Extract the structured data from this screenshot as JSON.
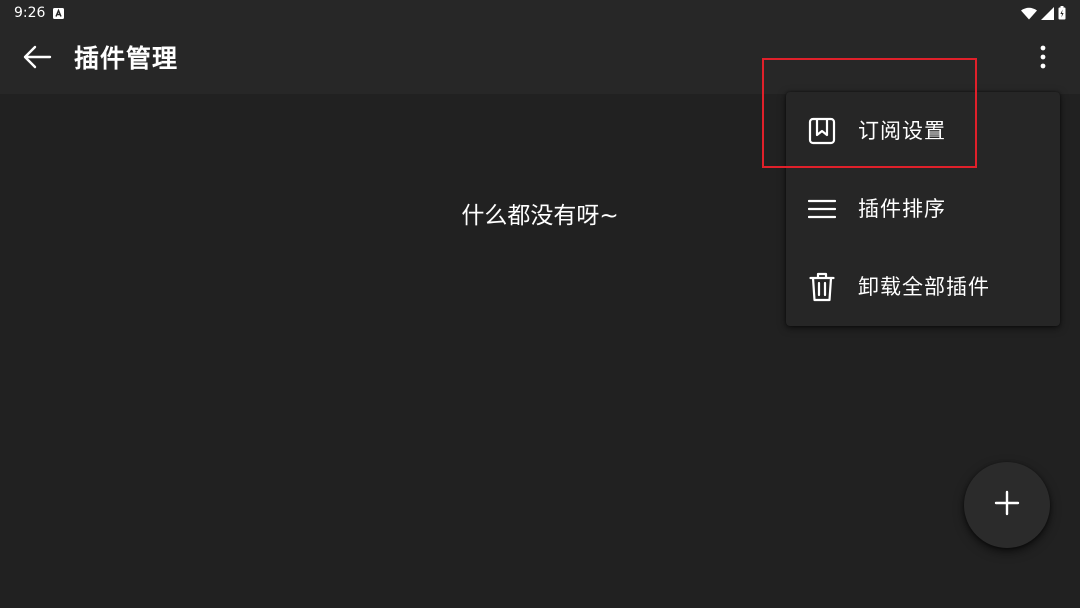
{
  "status_bar": {
    "time": "9:26",
    "icons": [
      "notification-a-icon",
      "wifi-icon",
      "cellular-signal-icon",
      "battery-icon"
    ]
  },
  "app_bar": {
    "title": "插件管理",
    "back_icon": "arrow-left-icon",
    "overflow_icon": "more-vert-icon"
  },
  "main": {
    "empty_text": "什么都没有呀~"
  },
  "popup_menu": {
    "items": [
      {
        "label": "订阅设置",
        "icon": "bookmark-icon"
      },
      {
        "label": "插件排序",
        "icon": "menu-lines-icon"
      },
      {
        "label": "卸载全部插件",
        "icon": "trash-icon"
      }
    ]
  },
  "highlight": {
    "target": "订阅设置",
    "color": "#e0202a"
  },
  "fab": {
    "icon": "plus-icon"
  },
  "colors": {
    "background": "#212121",
    "app_bar": "#272727",
    "menu_background": "#262626",
    "text": "#ffffff"
  }
}
